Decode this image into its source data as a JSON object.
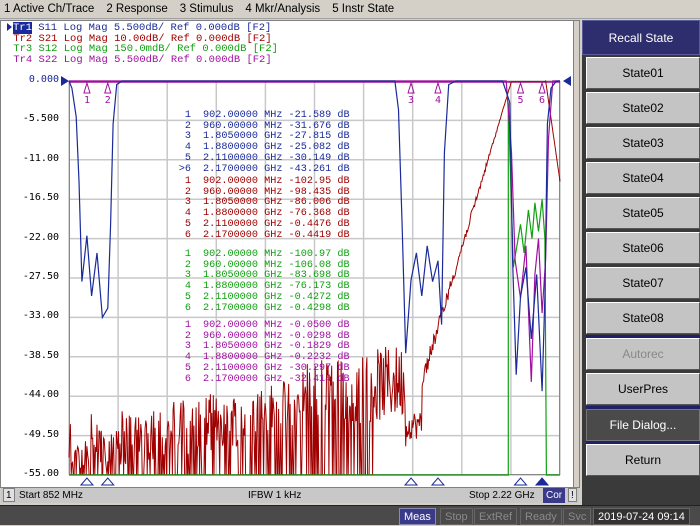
{
  "menu": [
    "1 Active Ch/Trace",
    "2 Response",
    "3 Stimulus",
    "4 Mkr/Analysis",
    "5 Instr State"
  ],
  "colors": {
    "tr1": "#1a2a9a",
    "tr2": "#a00000",
    "tr3": "#10a010",
    "tr4": "#a010a0",
    "grid": "#c8c8c8",
    "softkey_title": "#2e2e6e"
  },
  "traces": [
    {
      "id": "Tr1",
      "param": "S11",
      "format": "Log Mag",
      "scale": "5.500dB/",
      "ref": "Ref 0.000dB",
      "tag": "[F2]",
      "active": true
    },
    {
      "id": "Tr2",
      "param": "S21",
      "format": "Log Mag",
      "scale": "10.00dB/",
      "ref": "Ref 0.000dB",
      "tag": "[F2]",
      "active": false
    },
    {
      "id": "Tr3",
      "param": "S12",
      "format": "Log Mag",
      "scale": "150.0mdB/",
      "ref": "Ref 0.000dB",
      "tag": "[F2]",
      "active": false
    },
    {
      "id": "Tr4",
      "param": "S22",
      "format": "Log Mag",
      "scale": "5.500dB/",
      "ref": "Ref 0.000dB",
      "tag": "[F2]",
      "active": false
    }
  ],
  "chart_data": {
    "type": "line",
    "title": "",
    "xlabel": "",
    "ylabel": "",
    "x_start_label": "Start 852 MHz",
    "x_stop_label": "Stop 2.22 GHz",
    "x_range_mhz": [
      852,
      2220
    ],
    "ylim": [
      -55.0,
      0.0
    ],
    "y_ticks": [
      "0.000",
      "-5.500",
      "-11.00",
      "-16.50",
      "-22.00",
      "-27.50",
      "-33.00",
      "-38.50",
      "-44.00",
      "-49.50",
      "-55.00"
    ],
    "grid": true,
    "x_divisions": 10,
    "y_divisions": 10,
    "marker_tables": [
      {
        "trace": "Tr1",
        "color_key": "tr1",
        "rows": [
          {
            "n": "1",
            "freq": "902.00000 MHz",
            "value": "-21.589 dB"
          },
          {
            "n": "2",
            "freq": "960.00000 MHz",
            "value": "-31.676 dB"
          },
          {
            "n": "3",
            "freq": "1.8050000 GHz",
            "value": "-27.815 dB"
          },
          {
            "n": "4",
            "freq": "1.8800000 GHz",
            "value": "-25.082 dB"
          },
          {
            "n": "5",
            "freq": "2.1100000 GHz",
            "value": "-30.149 dB"
          },
          {
            "n": ">6",
            "freq": "2.1700000 GHz",
            "value": "-43.261 dB"
          }
        ]
      },
      {
        "trace": "Tr2",
        "color_key": "tr2",
        "rows": [
          {
            "n": "1",
            "freq": "902.00000 MHz",
            "value": "-102.95 dB"
          },
          {
            "n": "2",
            "freq": "960.00000 MHz",
            "value": "-98.435 dB"
          },
          {
            "n": "3",
            "freq": "1.8050000 GHz",
            "value": "-86.006 dB"
          },
          {
            "n": "4",
            "freq": "1.8800000 GHz",
            "value": "-76.368 dB"
          },
          {
            "n": "5",
            "freq": "2.1100000 GHz",
            "value": "-0.4476 dB"
          },
          {
            "n": "6",
            "freq": "2.1700000 GHz",
            "value": "-0.4419 dB"
          }
        ]
      },
      {
        "trace": "Tr3",
        "color_key": "tr3",
        "rows": [
          {
            "n": "1",
            "freq": "902.00000 MHz",
            "value": "-100.97 dB"
          },
          {
            "n": "2",
            "freq": "960.00000 MHz",
            "value": "-106.08 dB"
          },
          {
            "n": "3",
            "freq": "1.8050000 GHz",
            "value": "-83.698 dB"
          },
          {
            "n": "4",
            "freq": "1.8800000 GHz",
            "value": "-76.173 dB"
          },
          {
            "n": "5",
            "freq": "2.1100000 GHz",
            "value": "-0.4272 dB"
          },
          {
            "n": "6",
            "freq": "2.1700000 GHz",
            "value": "-0.4298 dB"
          }
        ]
      },
      {
        "trace": "Tr4",
        "color_key": "tr4",
        "rows": [
          {
            "n": "1",
            "freq": "902.00000 MHz",
            "value": "-0.0500 dB"
          },
          {
            "n": "2",
            "freq": "960.00000 MHz",
            "value": "-0.0298 dB"
          },
          {
            "n": "3",
            "freq": "1.8050000 GHz",
            "value": "-0.1829 dB"
          },
          {
            "n": "4",
            "freq": "1.8800000 GHz",
            "value": "-0.2232 dB"
          },
          {
            "n": "5",
            "freq": "2.1100000 GHz",
            "value": "-30.297 dB"
          },
          {
            "n": "6",
            "freq": "2.1700000 GHz",
            "value": "-32.414 dB"
          }
        ]
      }
    ],
    "marker_freqs_mhz": [
      902,
      960,
      1805,
      1880,
      2110,
      2170
    ],
    "series": [
      {
        "name": "Tr1 S11",
        "color_key": "tr1",
        "points_mhz_db": [
          [
            852,
            0
          ],
          [
            860,
            -1
          ],
          [
            872,
            -5
          ],
          [
            880,
            -14
          ],
          [
            888,
            -28
          ],
          [
            902,
            -21.6
          ],
          [
            915,
            -30
          ],
          [
            930,
            -24
          ],
          [
            945,
            -33
          ],
          [
            960,
            -31.7
          ],
          [
            968,
            -20
          ],
          [
            975,
            -6
          ],
          [
            985,
            -0.5
          ],
          [
            1000,
            0
          ],
          [
            1760,
            0
          ],
          [
            1770,
            -4
          ],
          [
            1780,
            -20
          ],
          [
            1790,
            -38
          ],
          [
            1805,
            -27.8
          ],
          [
            1820,
            -24
          ],
          [
            1835,
            -30
          ],
          [
            1850,
            -23
          ],
          [
            1865,
            -28
          ],
          [
            1880,
            -25.1
          ],
          [
            1890,
            -34
          ],
          [
            1898,
            -10
          ],
          [
            1910,
            -0.5
          ],
          [
            1930,
            0
          ],
          [
            2060,
            0
          ],
          [
            2080,
            -3
          ],
          [
            2088,
            -25
          ],
          [
            2098,
            -41
          ],
          [
            2110,
            -30.1
          ],
          [
            2125,
            -26
          ],
          [
            2140,
            -36
          ],
          [
            2155,
            -27
          ],
          [
            2170,
            -43.3
          ],
          [
            2178,
            -30
          ],
          [
            2185,
            -6
          ],
          [
            2195,
            -1
          ],
          [
            2210,
            0
          ],
          [
            2220,
            0
          ]
        ]
      },
      {
        "name": "Tr4 S22",
        "color_key": "tr4",
        "points_mhz_db": [
          [
            852,
            0
          ],
          [
            2070,
            0
          ],
          [
            2085,
            -10
          ],
          [
            2095,
            -25
          ],
          [
            2110,
            -30.3
          ],
          [
            2125,
            -23
          ],
          [
            2140,
            -42
          ],
          [
            2150,
            -27
          ],
          [
            2160,
            -22
          ],
          [
            2170,
            -32.4
          ],
          [
            2180,
            -25
          ],
          [
            2188,
            -8
          ],
          [
            2200,
            0
          ],
          [
            2220,
            0
          ]
        ]
      }
    ],
    "s21_curve_note": "S21 noise floor ~ -102 dB rising to 0 dB passband at 2.11-2.17 GHz, rolling off above",
    "s12_curve_note": "S12 clipped at bottom; passband between 2.11 and 2.17 GHz near -0.43 dB"
  },
  "status": {
    "channel": "1",
    "start": "Start 852 MHz",
    "ifbw": "IFBW 1 kHz",
    "stop": "Stop 2.22 GHz",
    "cor": "Cor",
    "excl": "!"
  },
  "bottom": {
    "meas": "Meas",
    "stop": "Stop",
    "extref": "ExtRef",
    "ready": "Ready",
    "svc": "Svc",
    "datetime": "2019-07-24 09:14"
  },
  "softkeys": {
    "title": "Recall State",
    "items": [
      {
        "label": "State01",
        "enabled": true
      },
      {
        "label": "State02",
        "enabled": true
      },
      {
        "label": "State03",
        "enabled": true
      },
      {
        "label": "State04",
        "enabled": true
      },
      {
        "label": "State05",
        "enabled": true
      },
      {
        "label": "State06",
        "enabled": true
      },
      {
        "label": "State07",
        "enabled": true
      },
      {
        "label": "State08",
        "enabled": true
      },
      {
        "label": "Autorec",
        "enabled": false
      },
      {
        "label": "UserPres",
        "enabled": true
      },
      {
        "label": "File Dialog...",
        "enabled": true
      },
      {
        "label": "Return",
        "enabled": true
      }
    ]
  },
  "ref_value_label": "0.000"
}
